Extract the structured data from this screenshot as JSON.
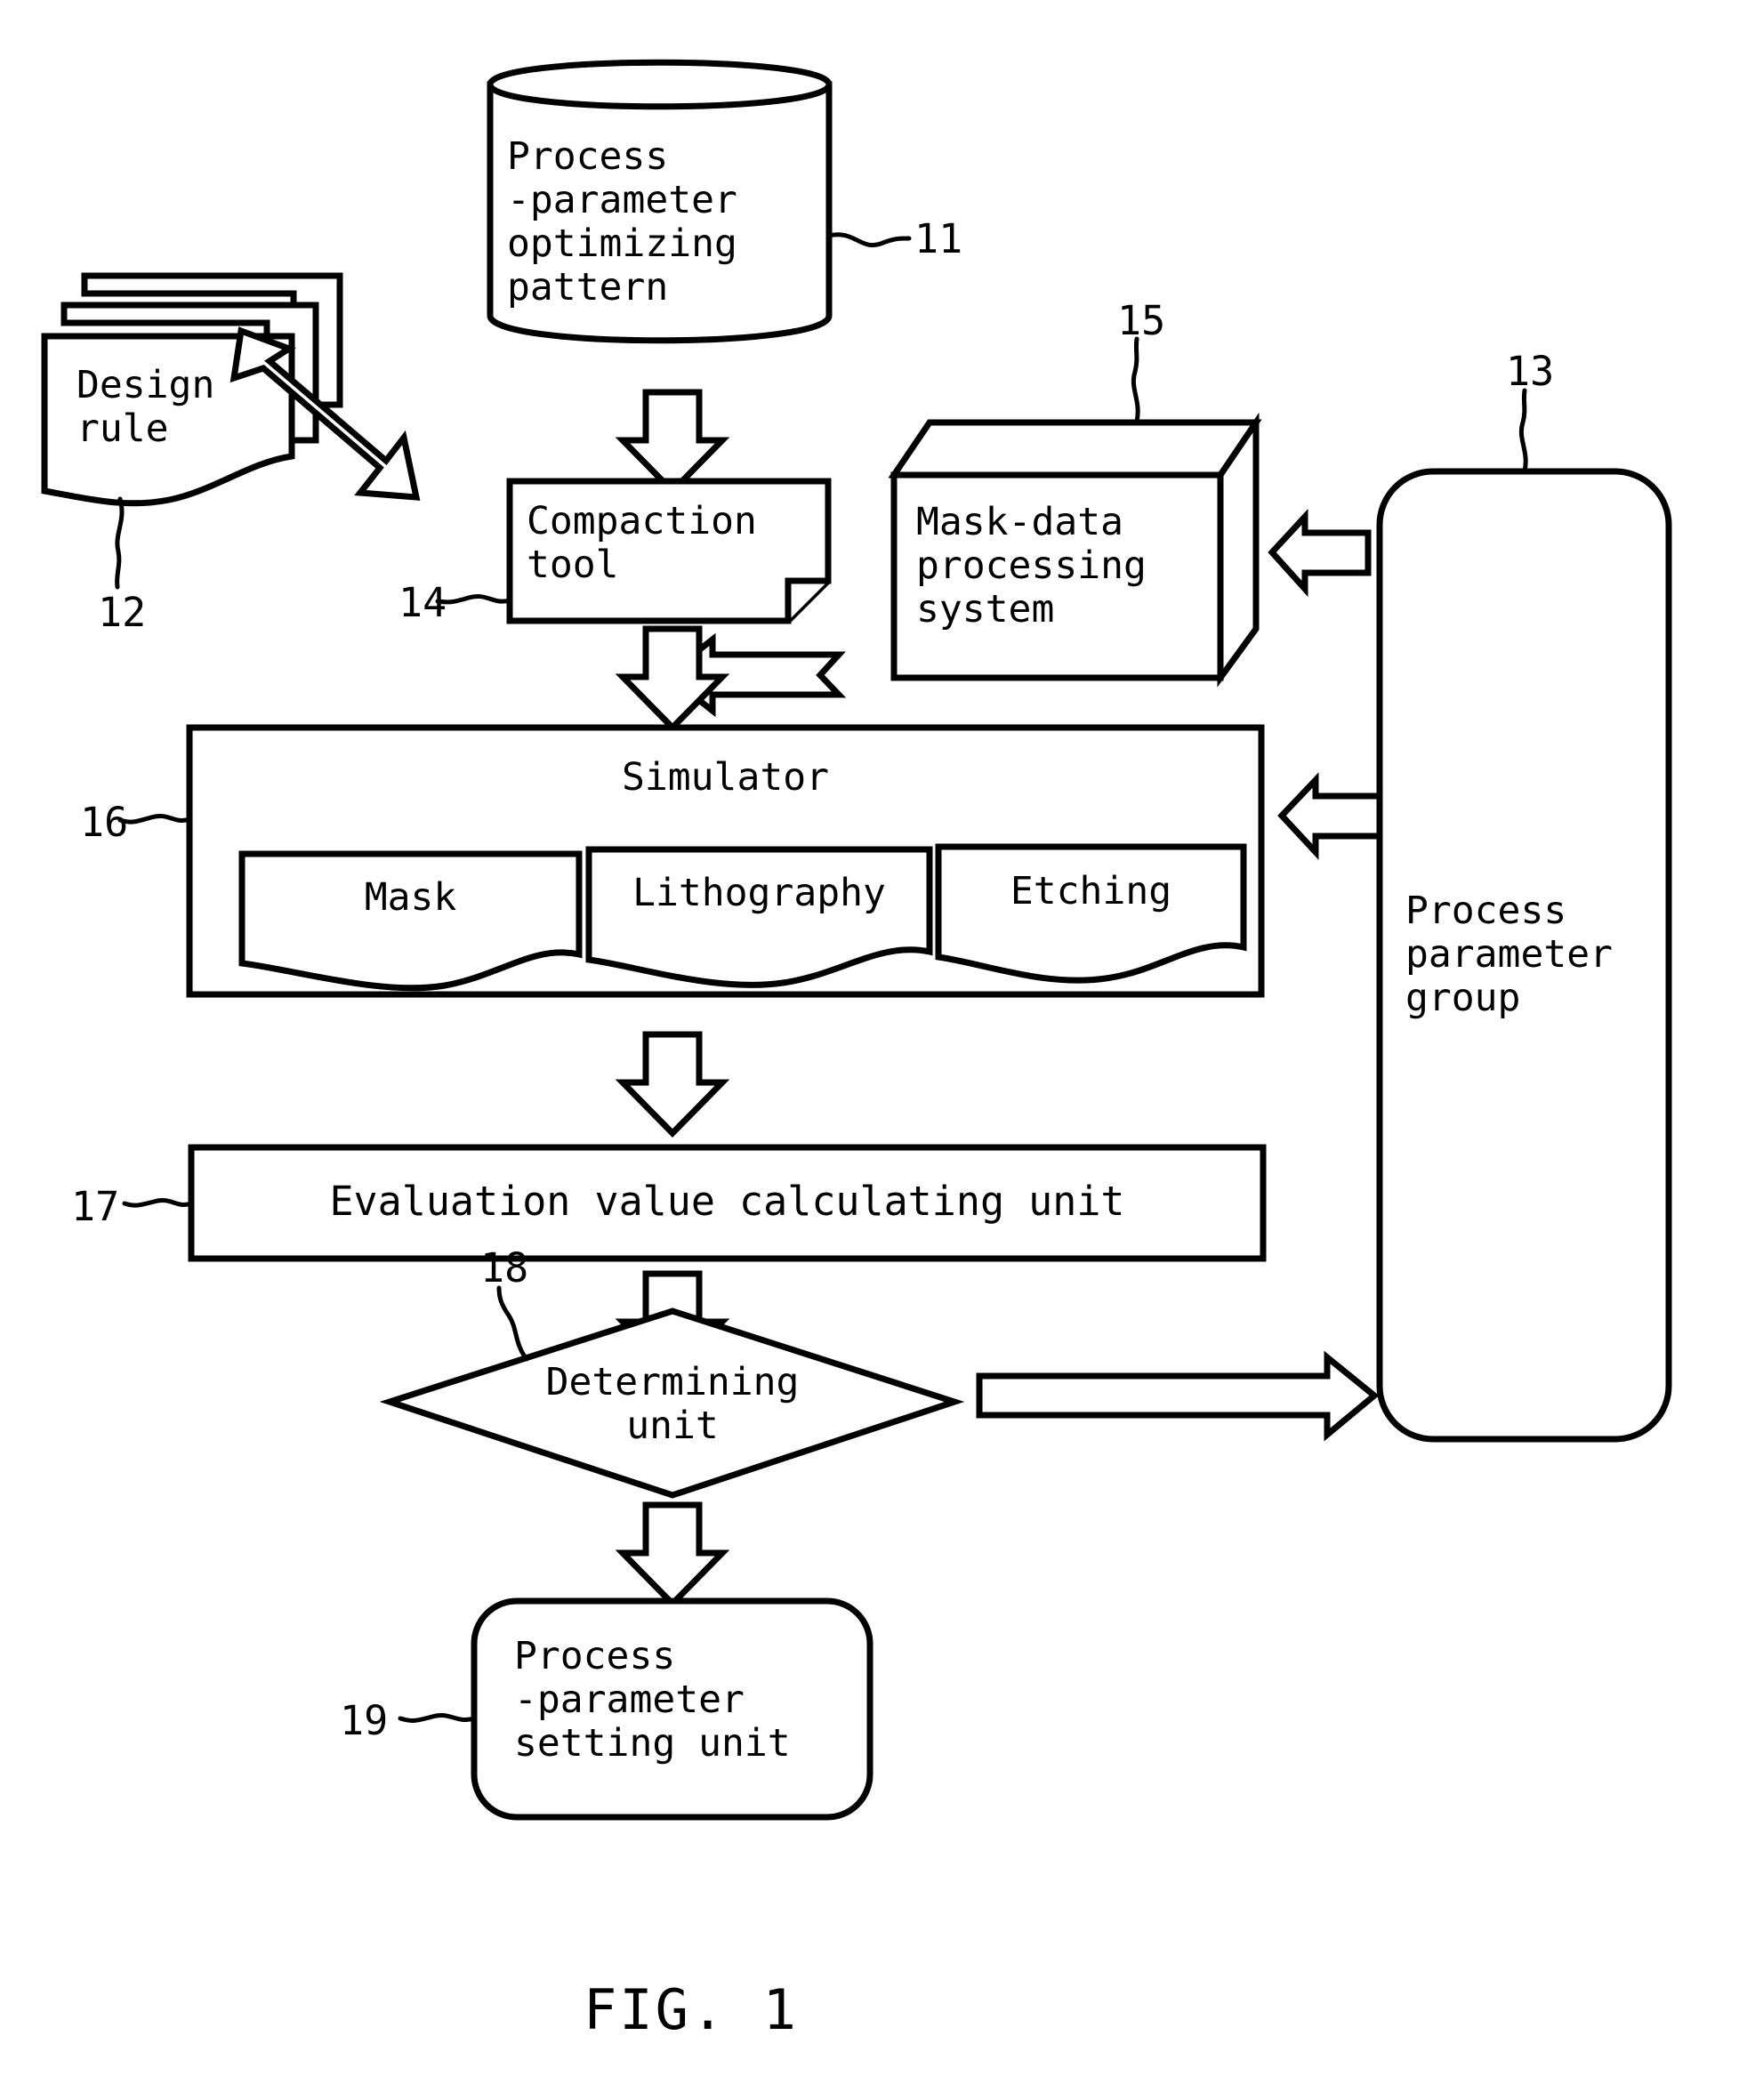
{
  "figure": {
    "caption": "FIG. 1",
    "type": "patent-block-diagram"
  },
  "nodes": {
    "optimizing_pattern": {
      "ref": "11",
      "shape": "cylinder",
      "lines": [
        "Process",
        "-parameter",
        "optimizing",
        "pattern"
      ]
    },
    "design_rule": {
      "ref": "12",
      "shape": "stacked-documents",
      "lines": [
        "Design",
        "rule"
      ]
    },
    "process_parameter_group": {
      "ref": "13",
      "shape": "rounded-rectangle",
      "lines": [
        "Process",
        "parameter",
        "group"
      ]
    },
    "compaction_tool": {
      "ref": "14",
      "shape": "folded-corner-box",
      "lines": [
        "Compaction",
        "tool"
      ]
    },
    "mask_data_system": {
      "ref": "15",
      "shape": "3d-box",
      "lines": [
        "Mask-data",
        "processing",
        "system"
      ]
    },
    "simulator": {
      "ref": "16",
      "shape": "rectangle",
      "title": "Simulator",
      "children": [
        {
          "label": "Mask",
          "shape": "document"
        },
        {
          "label": "Lithography",
          "shape": "document"
        },
        {
          "label": "Etching",
          "shape": "document"
        }
      ]
    },
    "evaluation_unit": {
      "ref": "17",
      "shape": "rectangle",
      "lines": [
        "Evaluation value calculating unit"
      ]
    },
    "determining_unit": {
      "ref": "18",
      "shape": "diamond",
      "lines": [
        "Determining",
        "unit"
      ]
    },
    "setting_unit": {
      "ref": "19",
      "shape": "rounded-rectangle",
      "lines": [
        "Process",
        "-parameter",
        "setting unit"
      ]
    }
  },
  "connectors": [
    {
      "name": "pattern-to-compaction",
      "style": "hollow-arrow",
      "direction": "down"
    },
    {
      "name": "designrule-to-compaction",
      "style": "hollow-arrow",
      "direction": "down-right"
    },
    {
      "name": "compaction-to-simulator",
      "style": "hollow-arrow",
      "direction": "down"
    },
    {
      "name": "maskdata-to-compaction-path",
      "style": "hollow-arrow",
      "direction": "left"
    },
    {
      "name": "paramgroup-to-maskdata",
      "style": "hollow-arrow",
      "direction": "left"
    },
    {
      "name": "paramgroup-to-simulator",
      "style": "hollow-arrow",
      "direction": "left"
    },
    {
      "name": "simulator-to-evaluation",
      "style": "hollow-arrow",
      "direction": "down"
    },
    {
      "name": "evaluation-to-determining",
      "style": "hollow-arrow",
      "direction": "down"
    },
    {
      "name": "determining-to-paramgroup",
      "style": "hollow-arrow",
      "direction": "right"
    },
    {
      "name": "determining-to-setting",
      "style": "hollow-arrow",
      "direction": "down"
    }
  ],
  "colors": {
    "ink": "#000000",
    "paper": "#ffffff"
  }
}
